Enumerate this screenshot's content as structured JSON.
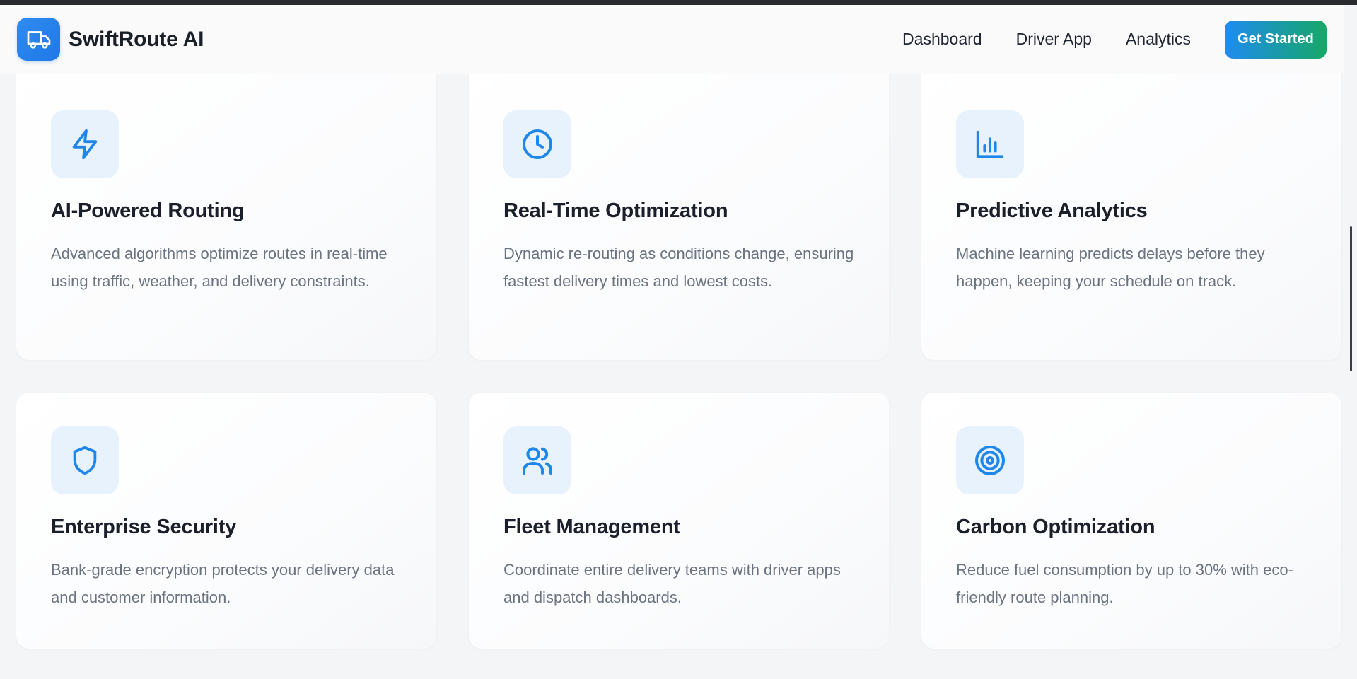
{
  "brand": {
    "name": "SwiftRoute AI",
    "logo_icon": "truck-icon"
  },
  "nav": {
    "links": [
      "Dashboard",
      "Driver App",
      "Analytics"
    ],
    "cta_label": "Get Started"
  },
  "colors": {
    "accent": "#1f8bf0",
    "accent_green": "#16a866",
    "icon_bg": "#e8f2fd",
    "muted_text": "#6b7280"
  },
  "features": [
    {
      "icon": "lightning-icon",
      "title": "AI-Powered Routing",
      "description": "Advanced algorithms optimize routes in real-time using traffic, weather, and delivery constraints."
    },
    {
      "icon": "clock-icon",
      "title": "Real-Time Optimization",
      "description": "Dynamic re-routing as conditions change, ensuring fastest delivery times and lowest costs."
    },
    {
      "icon": "bar-chart-icon",
      "title": "Predictive Analytics",
      "description": "Machine learning predicts delays before they happen, keeping your schedule on track."
    },
    {
      "icon": "shield-icon",
      "title": "Enterprise Security",
      "description": "Bank-grade encryption protects your delivery data and customer information."
    },
    {
      "icon": "users-icon",
      "title": "Fleet Management",
      "description": "Coordinate entire delivery teams with driver apps and dispatch dashboards."
    },
    {
      "icon": "target-icon",
      "title": "Carbon Optimization",
      "description": "Reduce fuel consumption by up to 30% with eco-friendly route planning."
    }
  ]
}
